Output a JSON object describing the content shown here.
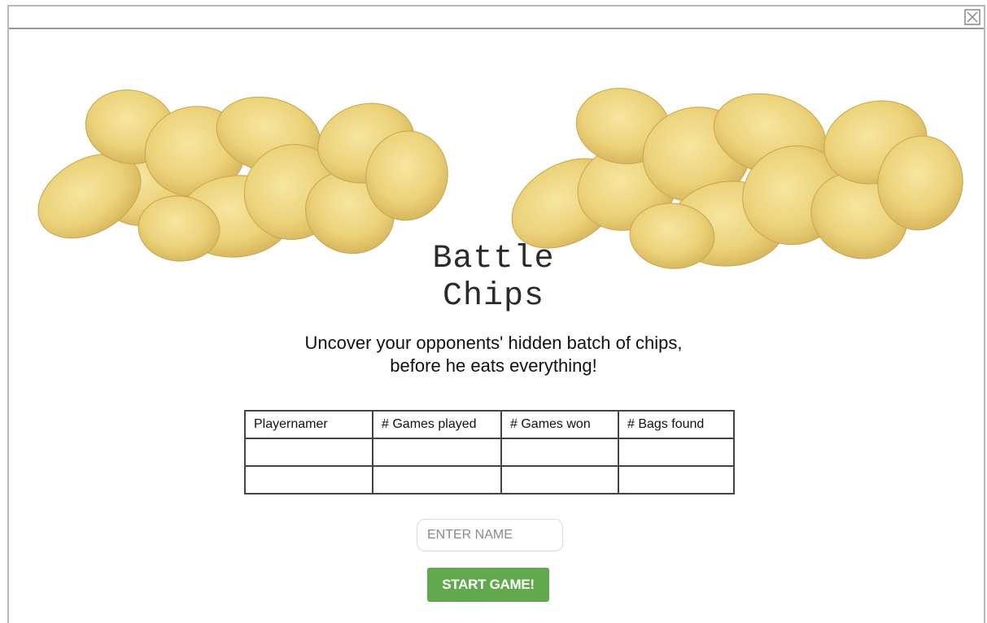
{
  "window": {
    "close_icon": "close-box-icon"
  },
  "hero": {
    "image_left": "potato-chips-image",
    "image_right": "potato-chips-image",
    "title_line1": "Battle",
    "title_line2": "Chips",
    "subtitle_line1": "Uncover your opponents' hidden batch of chips,",
    "subtitle_line2": "before he eats everything!"
  },
  "scoreboard": {
    "headers": [
      "Playernamer",
      "# Games played",
      "# Games won",
      "# Bags found"
    ],
    "rows": [
      [
        "",
        "",
        "",
        ""
      ],
      [
        "",
        "",
        "",
        ""
      ]
    ]
  },
  "form": {
    "name_placeholder": "ENTER NAME",
    "name_value": "",
    "start_label": "START GAME!"
  },
  "colors": {
    "start_button": "#62a84f",
    "chip_yellow": "#ecd27a"
  }
}
